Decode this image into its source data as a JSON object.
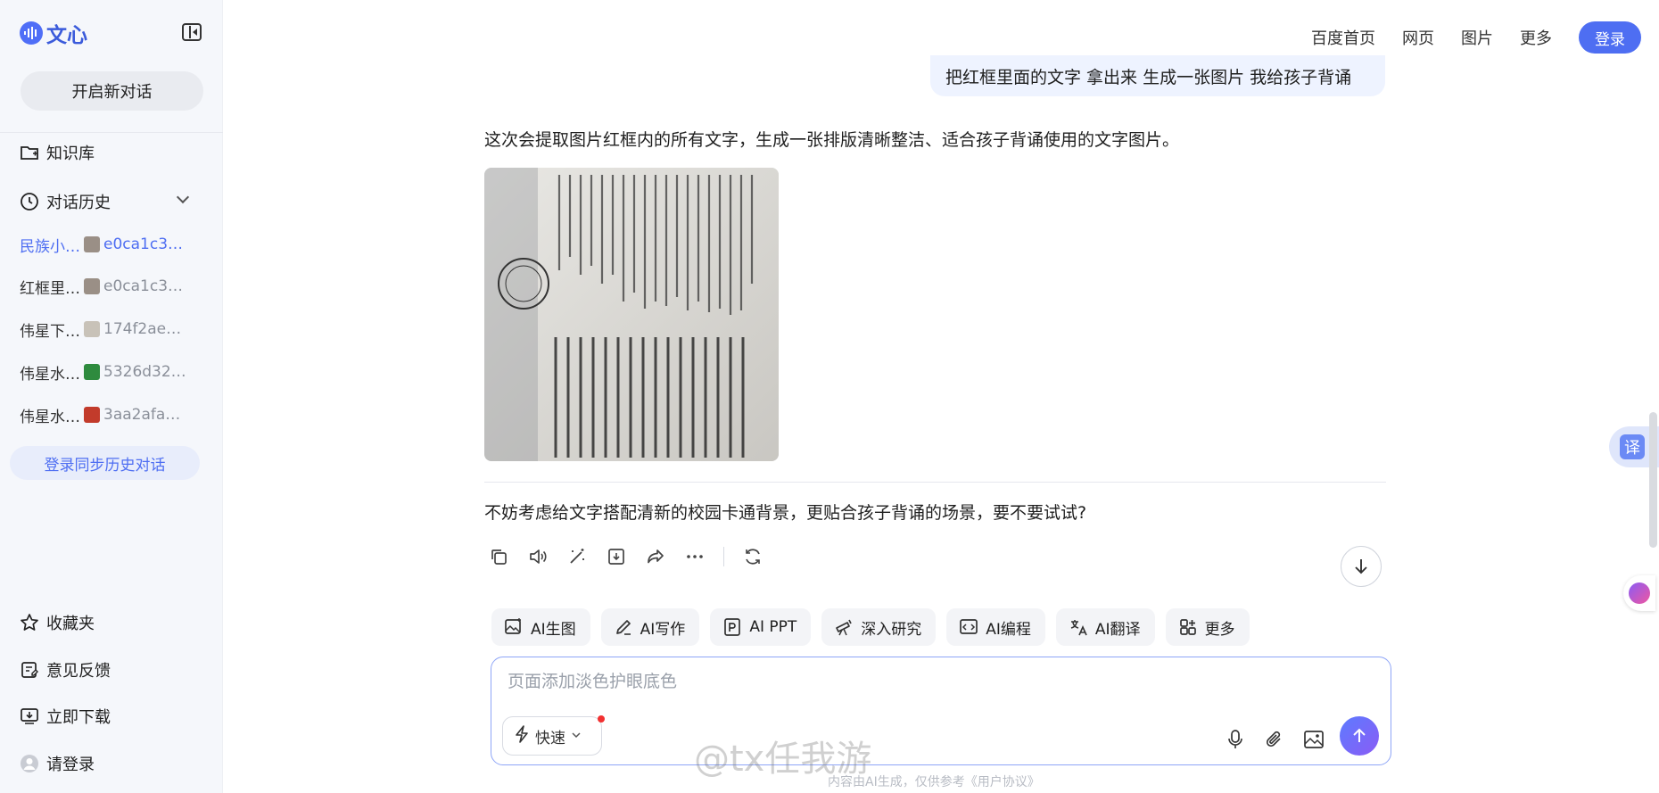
{
  "sidebar": {
    "logo_text": "文心",
    "new_chat_label": "开启新对话",
    "knowledge_label": "知识库",
    "history_label": "对话历史",
    "history_items": [
      {
        "title": "民族小…",
        "hash": "e0ca1c3…",
        "thumb_color": "#9a8f86",
        "active": true
      },
      {
        "title": "红框里…",
        "hash": "e0ca1c3…",
        "thumb_color": "#9a8f86",
        "active": false
      },
      {
        "title": "伟星下…",
        "hash": "174f2ae…",
        "thumb_color": "#c8c2b8",
        "active": false
      },
      {
        "title": "伟星水…",
        "hash": "5326d32…",
        "thumb_color": "#2e8b3e",
        "active": false
      },
      {
        "title": "伟星水…",
        "hash": "3aa2afa…",
        "thumb_color": "#c23b2b",
        "active": false
      }
    ],
    "sync_label": "登录同步历史对话",
    "favorites_label": "收藏夹",
    "feedback_label": "意见反馈",
    "download_label": "立即下载",
    "login_label": "请登录"
  },
  "topnav": {
    "links": [
      "百度首页",
      "网页",
      "图片",
      "更多"
    ],
    "login_label": "登录"
  },
  "chat": {
    "user_message": "把红框里面的文字 拿出来 生成一张图片 我给孩子背诵",
    "answer_intro": "这次会提取图片红框内的所有文字，生成一张排版清晰整洁、适合孩子背诵使用的文字图片。",
    "suggestion": "不妨考虑给文字搭配清新的校园卡通背景，更贴合孩子背诵的场景，要不要试试?"
  },
  "tools": [
    {
      "label": "AI生图",
      "icon": "image-gen-icon"
    },
    {
      "label": "AI写作",
      "icon": "pen-icon"
    },
    {
      "label": "AI PPT",
      "icon": "ppt-icon"
    },
    {
      "label": "深入研究",
      "icon": "telescope-icon"
    },
    {
      "label": "AI编程",
      "icon": "code-icon"
    },
    {
      "label": "AI翻译",
      "icon": "translate-icon"
    },
    {
      "label": "更多",
      "icon": "grid-plus-icon"
    }
  ],
  "composer": {
    "placeholder": "页面添加淡色护眼底色",
    "mode_label": "快速"
  },
  "footer": {
    "disclaimer": "内容由AI生成，仅供参考《用户协议》",
    "watermark": "@tx任我游"
  },
  "floating": {
    "translate_label": "译"
  },
  "colors": {
    "accent": "#4e6ef2",
    "sidebar_bg": "#f5f7fb",
    "bubble_bg": "#eef3ff"
  }
}
